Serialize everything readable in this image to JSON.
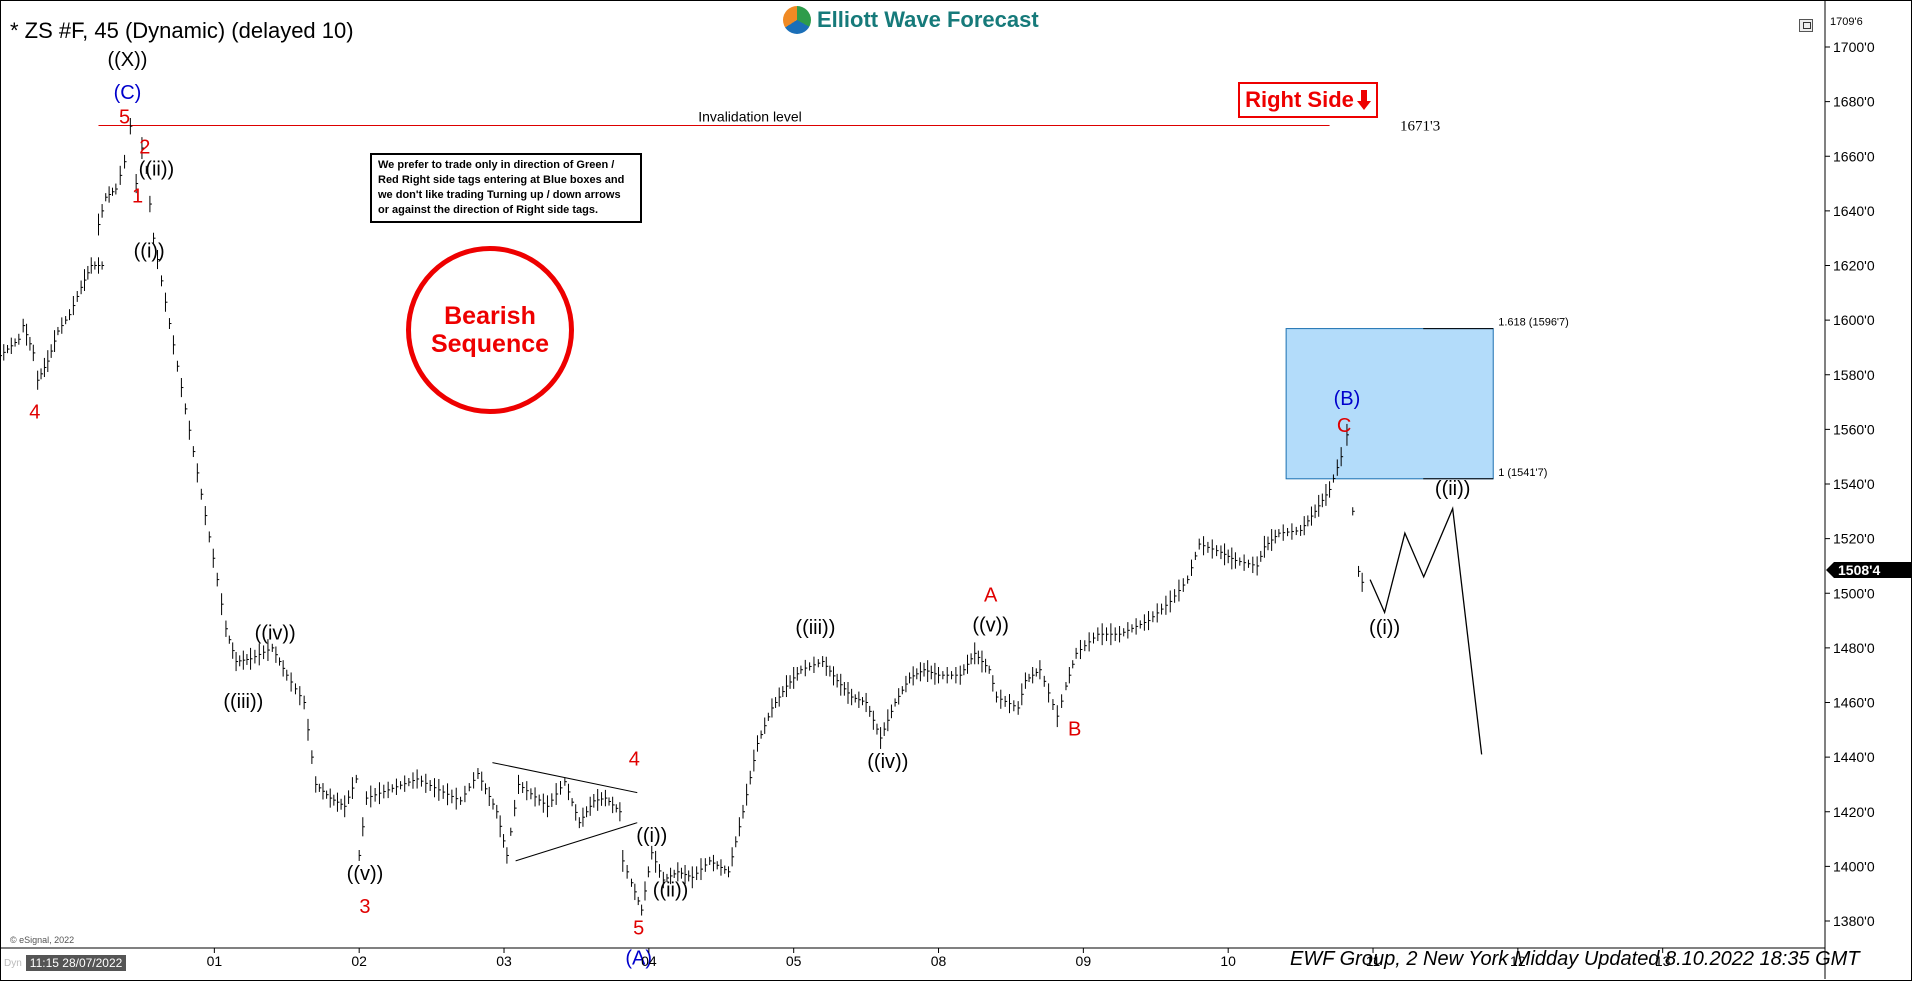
{
  "header": {
    "title": "* ZS #F, 45 (Dynamic) (delayed 10)",
    "logo_text": "Elliott Wave Forecast"
  },
  "note_box": {
    "text": "We prefer to trade only in direction of Green / Red Right side tags entering at Blue boxes and we don't like trading Turning up / down arrows or against the direction of Right side tags."
  },
  "bearish_badge": {
    "line1": "Bearish",
    "line2": "Sequence"
  },
  "right_side_tag": {
    "label": "Right Side",
    "arrow": "down-arrow"
  },
  "footer": {
    "dyn_label": "Dyn",
    "cursor_time": "11:15 28/07/2022",
    "copyright": "© eSignal, 2022",
    "update_text": "EWF Group, 2 New York Midday Updated 8.10.2022 18:35 GMT"
  },
  "colors": {
    "red": "#e00000",
    "blue": "#0000cc",
    "box_fill": "#b3dcfa",
    "box_border": "#1a6fb0"
  },
  "chart_data": {
    "type": "line",
    "title": "* ZS #F, 45 (Dynamic) (delayed 10)",
    "xlabel": "",
    "ylabel": "",
    "ylim": [
      1370,
      1712
    ],
    "y_ticks": [
      "1380'0",
      "1400'0",
      "1420'0",
      "1440'0",
      "1460'0",
      "1480'0",
      "1500'0",
      "1520'0",
      "1540'0",
      "1560'0",
      "1580'0",
      "1600'0",
      "1620'0",
      "1640'0",
      "1660'0",
      "1680'0",
      "1700'0"
    ],
    "y_tick_values": [
      1380,
      1400,
      1420,
      1440,
      1460,
      1480,
      1500,
      1520,
      1540,
      1560,
      1580,
      1600,
      1620,
      1640,
      1660,
      1680,
      1700
    ],
    "top_price_label": "1709'6",
    "last_price_label": "1508'4",
    "last_price": 1508.5,
    "x_ticks": [
      "01",
      "02",
      "03",
      "04",
      "05",
      "08",
      "09",
      "10",
      "11",
      "12",
      "13"
    ],
    "x_tick_pos": [
      0.8,
      1.8,
      2.8,
      3.8,
      4.8,
      5.8,
      6.8,
      7.8,
      8.8,
      9.8,
      10.8
    ],
    "x_range": [
      -0.68,
      11.9
    ],
    "invalidation": {
      "label": "Invalidation level",
      "value": 1671.25,
      "value_label": "1671'3",
      "x_start": 0.0,
      "x_end": 8.5
    },
    "blue_box": {
      "low": 1541.9,
      "high": 1596.9,
      "x_start": 8.2,
      "x_end": 9.63,
      "upper_label": "1.618 (1596'7)",
      "lower_label": "1 (1541'7)"
    },
    "price_path": [
      [
        -0.68,
        1587
      ],
      [
        -0.55,
        1593
      ],
      [
        -0.52,
        1598
      ],
      [
        -0.45,
        1588
      ],
      [
        -0.42,
        1578
      ],
      [
        -0.35,
        1585
      ],
      [
        -0.28,
        1596
      ],
      [
        -0.2,
        1602
      ],
      [
        -0.12,
        1612
      ],
      [
        -0.05,
        1620
      ],
      [
        0.05,
        1620
      ],
      [
        0.0,
        1635
      ],
      [
        0.05,
        1645
      ],
      [
        0.12,
        1648
      ],
      [
        0.18,
        1658
      ],
      [
        0.22,
        1671
      ],
      [
        0.26,
        1650
      ],
      [
        0.3,
        1663
      ],
      [
        0.33,
        1655
      ],
      [
        0.38,
        1630
      ],
      [
        0.82,
        1505
      ],
      [
        0.88,
        1487
      ],
      [
        0.95,
        1475
      ],
      [
        1.05,
        1476
      ],
      [
        1.2,
        1480
      ],
      [
        1.3,
        1470
      ],
      [
        1.42,
        1460
      ],
      [
        1.5,
        1430
      ],
      [
        1.6,
        1425
      ],
      [
        1.7,
        1422
      ],
      [
        1.78,
        1432
      ],
      [
        1.8,
        1404
      ],
      [
        1.85,
        1425
      ],
      [
        2.0,
        1428
      ],
      [
        2.2,
        1432
      ],
      [
        2.35,
        1428
      ],
      [
        2.5,
        1424
      ],
      [
        2.62,
        1434
      ],
      [
        2.75,
        1420
      ],
      [
        2.82,
        1404
      ],
      [
        2.9,
        1430
      ],
      [
        3.1,
        1422
      ],
      [
        3.22,
        1431
      ],
      [
        3.32,
        1416
      ],
      [
        3.42,
        1424
      ],
      [
        3.5,
        1425
      ],
      [
        3.6,
        1420
      ],
      [
        3.62,
        1402
      ],
      [
        3.68,
        1394
      ],
      [
        3.75,
        1384
      ],
      [
        3.82,
        1405
      ],
      [
        3.9,
        1395
      ],
      [
        4.0,
        1398
      ],
      [
        4.1,
        1396
      ],
      [
        4.22,
        1402
      ],
      [
        4.35,
        1398
      ],
      [
        4.45,
        1420
      ],
      [
        4.55,
        1445
      ],
      [
        4.65,
        1458
      ],
      [
        4.75,
        1466
      ],
      [
        4.85,
        1472
      ],
      [
        5.0,
        1475
      ],
      [
        5.1,
        1468
      ],
      [
        5.2,
        1462
      ],
      [
        5.3,
        1460
      ],
      [
        5.4,
        1447
      ],
      [
        5.5,
        1460
      ],
      [
        5.6,
        1469
      ],
      [
        5.7,
        1472
      ],
      [
        5.8,
        1470
      ],
      [
        5.95,
        1470
      ],
      [
        6.05,
        1478
      ],
      [
        6.15,
        1472
      ],
      [
        6.2,
        1462
      ],
      [
        6.35,
        1458
      ],
      [
        6.4,
        1468
      ],
      [
        6.5,
        1472
      ],
      [
        6.62,
        1455
      ],
      [
        6.68,
        1466
      ],
      [
        6.75,
        1478
      ],
      [
        6.9,
        1485
      ],
      [
        7.05,
        1485
      ],
      [
        7.25,
        1490
      ],
      [
        7.4,
        1497
      ],
      [
        7.52,
        1505
      ],
      [
        7.6,
        1518
      ],
      [
        7.75,
        1515
      ],
      [
        7.85,
        1512
      ],
      [
        8.0,
        1510
      ],
      [
        8.05,
        1517
      ],
      [
        8.15,
        1522
      ],
      [
        8.3,
        1523
      ],
      [
        8.4,
        1530
      ],
      [
        8.5,
        1538
      ],
      [
        8.58,
        1550
      ],
      [
        8.62,
        1558
      ],
      [
        8.66,
        1530
      ],
      [
        8.7,
        1508
      ],
      [
        8.75,
        1500
      ]
    ],
    "projection_path": [
      [
        8.78,
        1505
      ],
      [
        8.88,
        1493
      ],
      [
        9.02,
        1522
      ],
      [
        9.15,
        1506
      ],
      [
        9.35,
        1531
      ],
      [
        9.55,
        1441
      ]
    ],
    "triangle": {
      "upper": [
        [
          2.72,
          1438
        ],
        [
          3.72,
          1427
        ]
      ],
      "lower": [
        [
          2.88,
          1402
        ],
        [
          3.72,
          1416
        ]
      ]
    },
    "wave_labels": [
      {
        "text": "((X))",
        "x": 0.2,
        "y": 1693,
        "color": "#000",
        "size": 20
      },
      {
        "text": "(C)",
        "x": 0.2,
        "y": 1681,
        "color": "#0000cc",
        "size": 20
      },
      {
        "text": "5",
        "x": 0.18,
        "y": 1672,
        "color": "#e00000",
        "size": 20
      },
      {
        "text": "2",
        "x": 0.32,
        "y": 1661,
        "color": "#e00000",
        "size": 20
      },
      {
        "text": "((ii))",
        "x": 0.4,
        "y": 1653,
        "color": "#000",
        "size": 20
      },
      {
        "text": "1",
        "x": 0.27,
        "y": 1643,
        "color": "#e00000",
        "size": 20
      },
      {
        "text": "((i))",
        "x": 0.35,
        "y": 1623,
        "color": "#000",
        "size": 20
      },
      {
        "text": "4",
        "x": -0.44,
        "y": 1564,
        "color": "#e00000",
        "size": 20
      },
      {
        "text": "((iv))",
        "x": 1.22,
        "y": 1483,
        "color": "#000",
        "size": 20
      },
      {
        "text": "((iii))",
        "x": 1.0,
        "y": 1458,
        "color": "#000",
        "size": 20
      },
      {
        "text": "((v))",
        "x": 1.84,
        "y": 1395,
        "color": "#000",
        "size": 20
      },
      {
        "text": "3",
        "x": 1.84,
        "y": 1383,
        "color": "#e00000",
        "size": 20
      },
      {
        "text": "4",
        "x": 3.7,
        "y": 1437,
        "color": "#e00000",
        "size": 20
      },
      {
        "text": "((i))",
        "x": 3.82,
        "y": 1409,
        "color": "#000",
        "size": 20
      },
      {
        "text": "((ii))",
        "x": 3.95,
        "y": 1389,
        "color": "#000",
        "size": 20
      },
      {
        "text": "5",
        "x": 3.73,
        "y": 1375,
        "color": "#e00000",
        "size": 20
      },
      {
        "text": "(A)",
        "x": 3.73,
        "y": 1364,
        "color": "#0000cc",
        "size": 20
      },
      {
        "text": "((iii))",
        "x": 4.95,
        "y": 1485,
        "color": "#000",
        "size": 20
      },
      {
        "text": "((iv))",
        "x": 5.45,
        "y": 1436,
        "color": "#000",
        "size": 20
      },
      {
        "text": "A",
        "x": 6.16,
        "y": 1497,
        "color": "#e00000",
        "size": 20
      },
      {
        "text": "((v))",
        "x": 6.16,
        "y": 1486,
        "color": "#000",
        "size": 20
      },
      {
        "text": "B",
        "x": 6.74,
        "y": 1448,
        "color": "#e00000",
        "size": 20
      },
      {
        "text": "(B)",
        "x": 8.62,
        "y": 1569,
        "color": "#0000cc",
        "size": 20
      },
      {
        "text": "C",
        "x": 8.6,
        "y": 1559,
        "color": "#e00000",
        "size": 20
      },
      {
        "text": "((ii))",
        "x": 9.35,
        "y": 1536,
        "color": "#000",
        "size": 20
      },
      {
        "text": "((i))",
        "x": 8.88,
        "y": 1485,
        "color": "#000",
        "size": 20
      }
    ]
  }
}
